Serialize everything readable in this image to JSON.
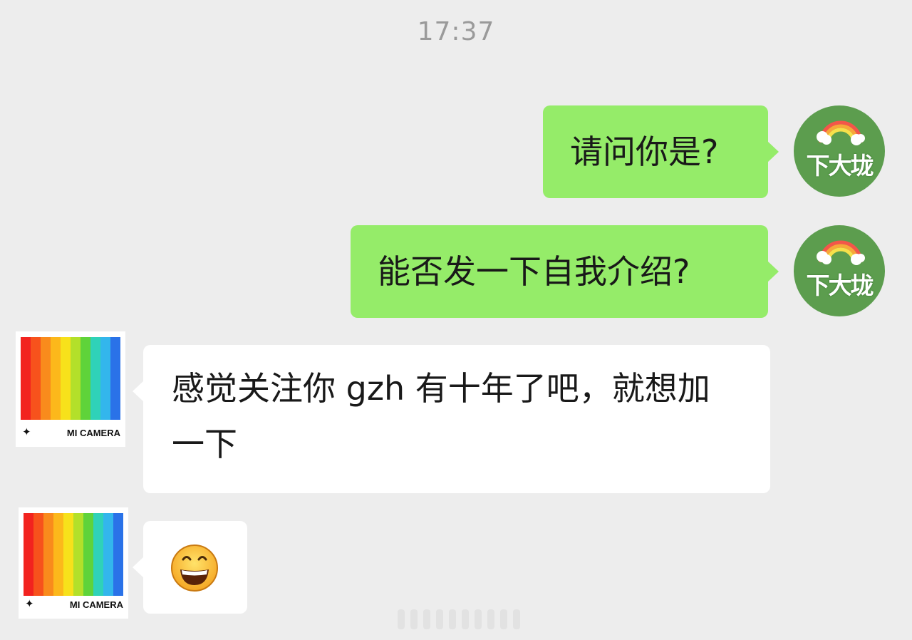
{
  "header": {
    "timestamp": "17:37"
  },
  "self_avatar": {
    "text": "下大垅"
  },
  "contact_avatar": {
    "label": "MI CAMERA",
    "star": "✦"
  },
  "messages": [
    {
      "from": "self",
      "text": "请问你是?"
    },
    {
      "from": "self",
      "text": "能否发一下自我介绍?"
    },
    {
      "from": "contact",
      "text": "感觉关注你 gzh 有十年了吧，就想加一下"
    },
    {
      "from": "contact",
      "emoji": "grinning-face"
    }
  ],
  "colors": {
    "background": "#ededed",
    "sent_bubble": "#95ec69",
    "received_bubble": "#ffffff",
    "self_avatar_bg": "#5c9d4e",
    "stripes": [
      "#f2231f",
      "#f7521c",
      "#f98b1c",
      "#fcb81b",
      "#f7e11b",
      "#b3e02a",
      "#5fd33a",
      "#2fd2b8",
      "#33b6ec",
      "#2a72e8"
    ]
  }
}
